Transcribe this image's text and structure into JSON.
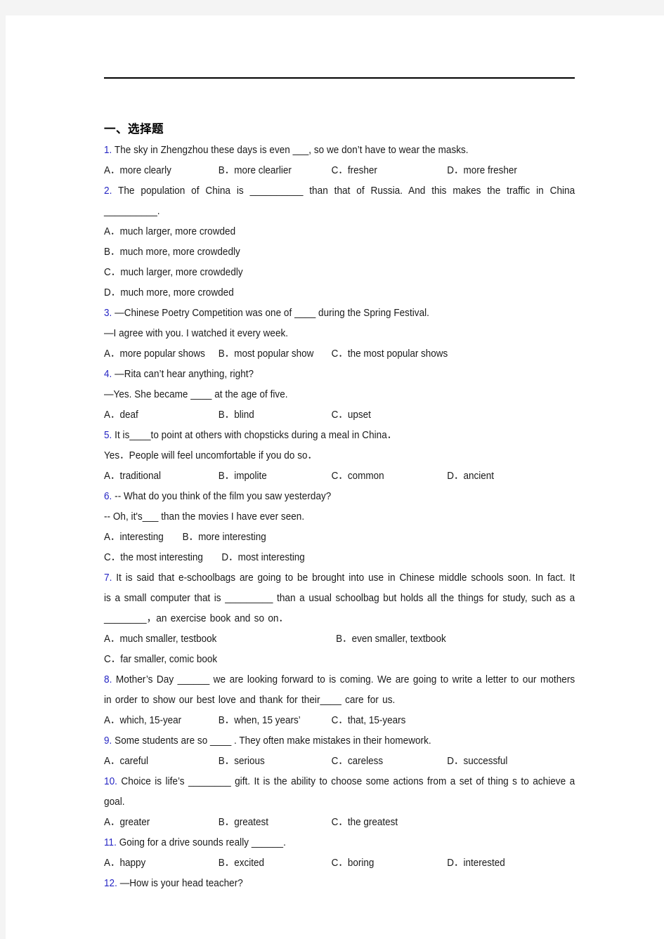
{
  "document": {
    "section_heading": "一、选择题",
    "questions": [
      {
        "number": "1.",
        "stem": "The sky in Zhengzhou these days is even  ___, so we don’t have to wear the masks.",
        "options_layout": "four-column",
        "options": [
          "A．more clearly",
          "B．more clearlier",
          "C．fresher",
          "D．more fresher"
        ]
      },
      {
        "number": "2.",
        "stem": "The population of China is __________ than that of Russia. And this makes the traffic in China __________.",
        "options_layout": "stacked",
        "options": [
          "A．much larger, more crowded",
          "B．much more, more crowdedly",
          "C．much larger, more crowdedly",
          "D．much more, more crowded"
        ]
      },
      {
        "number": "3.",
        "stem_lines": [
          "—Chinese Poetry Competition was one of  ____ during the Spring Festival.",
          "—I agree with you. I watched it every week."
        ],
        "options_layout": "three-column",
        "options": [
          "A．more popular shows",
          "B．most popular show",
          "C．the most popular  shows"
        ]
      },
      {
        "number": "4.",
        "stem_lines": [
          "—Rita can’t hear anything, right?",
          "—Yes. She became  ____ at the age of five."
        ],
        "options_layout": "three-column",
        "options": [
          "A．deaf",
          "B．blind",
          "C．upset"
        ]
      },
      {
        "number": "5.",
        "stem_lines": [
          "It is____to point at others with chopsticks during a meal in China．",
          "Yes．People will feel uncomfortable if you do so．"
        ],
        "options_layout": "four-column",
        "options": [
          "A．traditional",
          "B．impolite",
          "C．common",
          "D．ancient"
        ]
      },
      {
        "number": "6.",
        "stem_lines": [
          "-- What do you think of the film you saw yesterday?",
          "-- Oh, it's___ than the movies I have ever seen."
        ],
        "options_layout": "narrow-two-rows",
        "options": [
          "A．interesting",
          "B．more interesting",
          "C．the most interesting",
          "D．most interesting"
        ]
      },
      {
        "number": "7.",
        "stem": "It is said that e-schoolbags are going to be brought into use in Chinese middle schools soon. In fact. It is a small computer that is _________ than a usual schoolbag but holds all the things for study, such as a ________，an exercise book and so on．",
        "options_layout": "wide-two-rows",
        "options": [
          "A．much smaller, testbook",
          "B．even smaller, textbook",
          "C．far smaller, comic book"
        ]
      },
      {
        "number": "8.",
        "stem": "Mother’s Day ______ we are looking forward to is coming. We are going to write a letter to our mothers in order to show our best love and thank for their____ care for us.",
        "options_layout": "three-column",
        "options": [
          "A．which, 15-year",
          "B．when, 15 years’",
          "C．that, 15-years"
        ]
      },
      {
        "number": "9.",
        "stem": "Some students are so  ____  . They often make mistakes in their homework.",
        "options_layout": "four-column",
        "options": [
          "A．careful",
          "B．serious",
          "C．careless",
          "D．successful"
        ]
      },
      {
        "number": "10.",
        "stem": "Choice is life’s ________ gift. It is the ability to choose some actions from a set of thing s to achieve a goal.",
        "options_layout": "three-column",
        "options": [
          "A．greater",
          "B．greatest",
          "C．the greatest"
        ]
      },
      {
        "number": "11.",
        "stem": "Going for a drive sounds really ______.",
        "options_layout": "four-column",
        "options": [
          "A．happy",
          "B．excited",
          "C．boring",
          "D．interested"
        ]
      },
      {
        "number": "12.",
        "stem": "—How is your head teacher?",
        "options_layout": "none",
        "options": []
      }
    ]
  },
  "lines": {
    "q1_stem": "The sky in Zhengzhou these days is even     ___, so we don’t have to wear the masks.",
    "q1_a": "A．more clearly",
    "q1_b": "B．more clearlier",
    "q1_c": "C．fresher",
    "q1_d": "D．more fresher",
    "q2_stem": "The population of China is __________ than that of Russia. And this makes the traffic in China __________.",
    "q2_a": "A．much larger, more crowded",
    "q2_b": "B．much more, more crowdedly",
    "q2_c": "C．much larger, more crowdedly",
    "q2_d": "D．much more, more crowded",
    "q3_stem1": "—Chinese Poetry Competition was one of     ____  during the Spring Festival.",
    "q3_stem2": "—I agree with you. I watched it every week.",
    "q3_a": "A．more popular shows",
    "q3_b": "B．most popular show",
    "q3_c": "C．the most popular     shows",
    "q4_stem1": "—Rita can’t hear anything, right?",
    "q4_stem2": "—Yes. She became     ____  at the age of five.",
    "q4_a": "A．deaf",
    "q4_b": "B．blind",
    "q4_c": "C．upset",
    "q5_stem1": "It is____to point at others with chopsticks during a meal in China．",
    "q5_stem2": "Yes．People will feel uncomfortable if you do so．",
    "q5_a": "A．traditional",
    "q5_b": "B．impolite",
    "q5_c": "C．common",
    "q5_d": "D．ancient",
    "q6_stem1": "-- What do you think of the film you saw yesterday?",
    "q6_stem2": "-- Oh, it's___ than the movies I have ever seen.",
    "q6_a": "A．interesting",
    "q6_b": "B．more interesting",
    "q6_c": "C．the most interesting",
    "q6_d": "D．most interesting",
    "q7_stem": "It is said that e-schoolbags are going to be brought into use in Chinese middle schools soon. In fact. It is a small computer that is _________ than a usual schoolbag but holds all the things for study, such as a ________，an exercise book and so on．",
    "q7_a": "A．much smaller, testbook",
    "q7_b": "B．even smaller, textbook",
    "q7_c": "C．far smaller, comic book",
    "q8_stem": "Mother’s Day ______ we are looking forward to is coming. We are going to write a letter to our mothers in order to show our best love and thank for their____ care for us.",
    "q8_a": "A．which, 15-year",
    "q8_b": "B．when, 15 years’",
    "q8_c": "C．that, 15-years",
    "q9_stem": "Some students are so     ____   . They often make mistakes in their homework.",
    "q9_a": "A．careful",
    "q9_b": "B．serious",
    "q9_c": "C．careless",
    "q9_d": "D．successful",
    "q10_stem": "Choice is life’s ________ gift. It is the ability to choose some actions from a set of thing s to achieve a goal.",
    "q10_a": "A．greater",
    "q10_b": "B．greatest",
    "q10_c": "C．the greatest",
    "q11_stem": "Going for a drive sounds really ______.",
    "q11_a": "A．happy",
    "q11_b": "B．excited",
    "q11_c": "C．boring",
    "q11_d": "D．interested",
    "q12_stem": "—How is your head teacher?"
  },
  "numbers": {
    "n1": "1.",
    "n2": "2.",
    "n3": "3.",
    "n4": "4.",
    "n5": "5.",
    "n6": "6.",
    "n7": "7.",
    "n8": "8.",
    "n9": "9.",
    "n10": "10.",
    "n11": "11.",
    "n12": "12."
  },
  "colors": {
    "question_number": "#2626c4",
    "text": "#1a1a1a",
    "page_background": "#ffffff",
    "canvas_background": "#f4f4f4",
    "rule": "#000000"
  }
}
